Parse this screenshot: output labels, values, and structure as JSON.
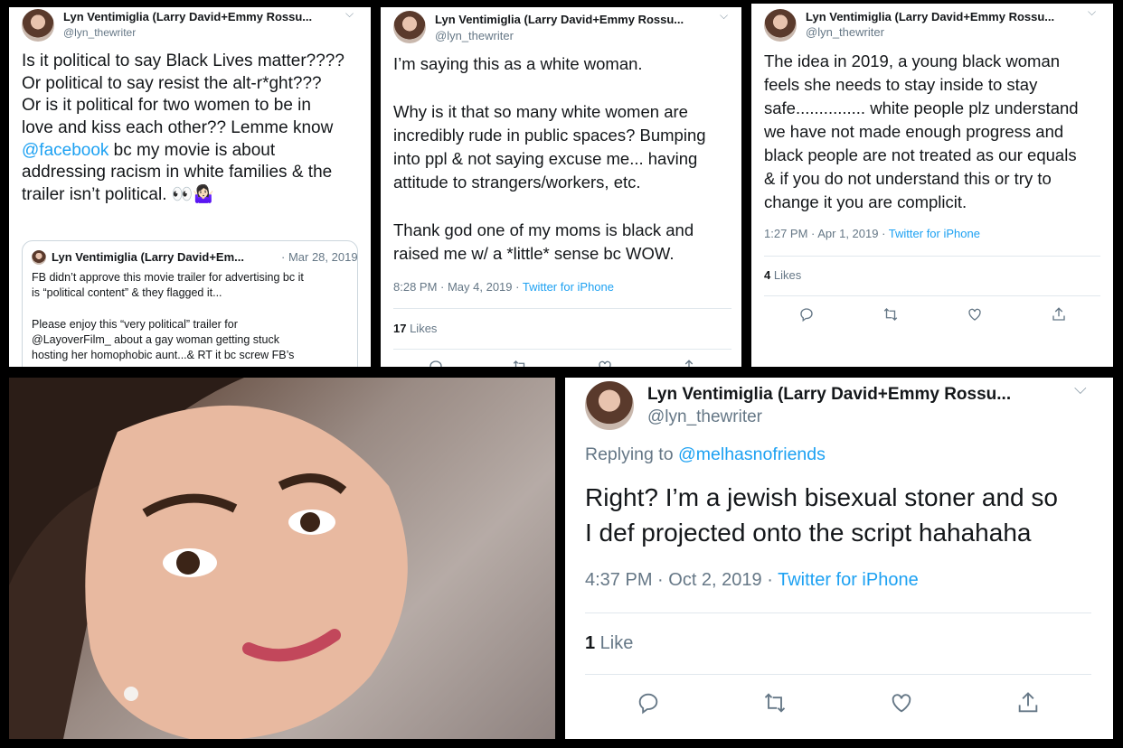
{
  "tweets": [
    {
      "name": "Lyn Ventimiglia (Larry David+Emmy Rossu...",
      "handle": "@lyn_thewriter",
      "text_lines": [
        "Is it political to say Black Lives matter????",
        "Or political to say resist the alt-r*ght???",
        "Or is it political for two women to be in",
        "love and kiss each other?? Lemme know"
      ],
      "mention": "@facebook",
      "after_mention": " bc my movie is about",
      "text_lines_2": [
        "addressing racism in white families & the",
        "trailer isn’t political. 👀🤷🏻‍♀️"
      ],
      "quote": {
        "name": "Lyn Ventimiglia (Larry David+Em...",
        "date": "· Mar 28, 2019",
        "line1": "FB didn’t approve this movie trailer for advertising bc it",
        "line2": "is “political content” & they flagged it...",
        "line3": "Please enjoy this “very political” trailer for",
        "line4": "@LayoverFilm_ about a gay woman getting stuck",
        "line5": "hosting her homophobic aunt...& RT it bc screw FB’s"
      }
    },
    {
      "name": "Lyn Ventimiglia (Larry David+Emmy Rossu...",
      "handle": "@lyn_thewriter",
      "para1": "I’m saying this as a white woman.",
      "para2": [
        "Why is it that so many white women are",
        "incredibly rude in public spaces? Bumping",
        "into ppl & not saying excuse me... having",
        "attitude to strangers/workers, etc."
      ],
      "para3": [
        "Thank god one of my moms is black and",
        "raised me w/ a *little* sense bc WOW."
      ],
      "time": "8:28 PM · May 4, 2019 · ",
      "source": "Twitter for iPhone",
      "likes_count": "17",
      "likes_label": " Likes"
    },
    {
      "name": "Lyn Ventimiglia (Larry David+Emmy Rossu...",
      "handle": "@lyn_thewriter",
      "text_lines": [
        "The idea in 2019, a young black woman",
        "feels she needs to stay inside to stay",
        "safe............... white people plz understand",
        "we have not made enough progress and",
        "black people are not treated as our equals",
        "& if you do not understand this or try to",
        "change it you are complicit."
      ],
      "time": "1:27 PM · Apr 1, 2019 · ",
      "source": "Twitter for iPhone",
      "likes_count": "4",
      "likes_label": " Likes"
    },
    {
      "name": "Lyn Ventimiglia (Larry David+Emmy Rossu...",
      "handle": "@lyn_thewriter",
      "replying_label": "Replying to ",
      "replying_to": "@melhasnofriends",
      "text_lines": [
        "Right? I’m a jewish bisexual stoner and so",
        "I def projected onto the script hahahaha"
      ],
      "time": "4:37 PM · Oct 2, 2019 · ",
      "source": "Twitter for iPhone",
      "likes_count": "1",
      "likes_label": " Like"
    }
  ],
  "colors": {
    "link": "#1da1f2",
    "muted": "#657786",
    "text": "#14171a"
  }
}
